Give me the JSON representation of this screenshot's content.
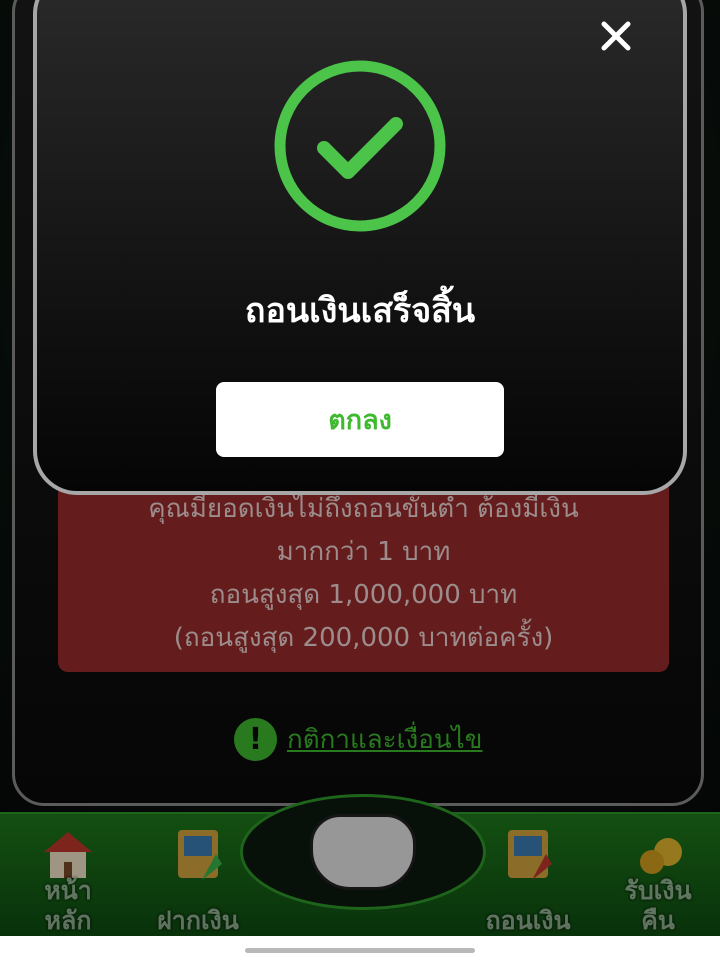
{
  "modal": {
    "title": "ถอนเงินเสร็จสิ้น",
    "ok_label": "ตกลง",
    "success_color": "#4cc44a"
  },
  "info": {
    "lines": [
      "คุณมียอดเงินไม่ถึงถอนขั้นต่ำ ต้องมีเงิน",
      "มากกว่า 1 บาท",
      "ถอนสูงสุด 1,000,000 บาท",
      "(ถอนสูงสุด 200,000 บาทต่อครั้ง)"
    ]
  },
  "terms": {
    "icon": "!",
    "link_label": "กติกาและเงื่อนไข"
  },
  "bottom_nav": {
    "items": [
      {
        "label_line1": "หน้า",
        "label_line2": "หลัก",
        "icon": "house-icon"
      },
      {
        "label_line1": "",
        "label_line2": "ฝากเงิน",
        "icon": "deposit-atm-icon"
      },
      {
        "label_line1": "",
        "label_line2": "ถอนเงิน",
        "icon": "withdraw-atm-icon"
      },
      {
        "label_line1": "รับเงิน",
        "label_line2": "คืน",
        "icon": "cashback-coins-icon"
      }
    ]
  }
}
